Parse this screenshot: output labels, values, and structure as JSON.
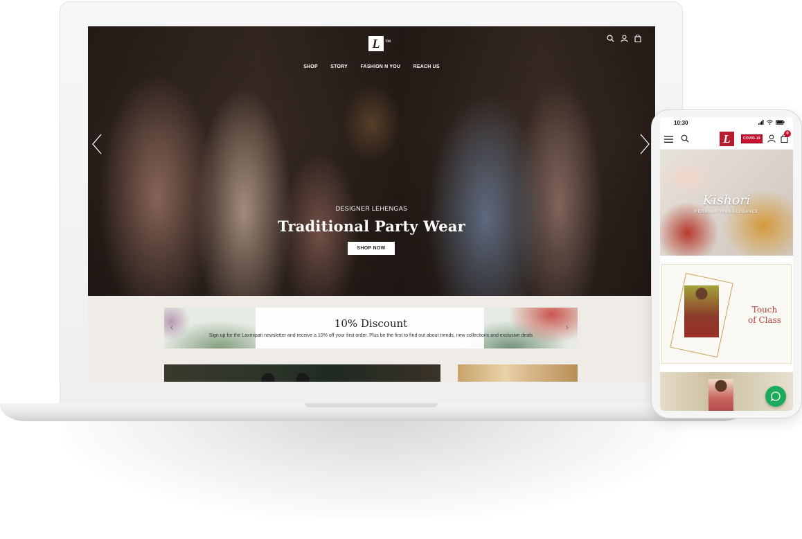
{
  "desktop": {
    "brand": {
      "logo_letter": "L",
      "trademark": "TM"
    },
    "nav": {
      "items": [
        "SHOP",
        "STORY",
        "FASHION N YOU",
        "REACH US"
      ]
    },
    "header_icons": [
      "search-icon",
      "user-icon",
      "bag-icon"
    ],
    "hero": {
      "subtitle": "DESIGNER LEHENGAS",
      "title": "Traditional Party Wear",
      "cta_label": "SHOP NOW",
      "prev_icon": "chevron-left-icon",
      "next_icon": "chevron-right-icon"
    },
    "discount": {
      "title": "10% Discount",
      "text": "Sign up for the Laxmipati newsletter and receive a 10% off your first order. Plus be the first to find out about trends, new collections and exclusive deals"
    }
  },
  "mobile": {
    "status": {
      "time": "10:30"
    },
    "header": {
      "logo_letter": "L",
      "badge": "COVID-19",
      "cart_count": "0"
    },
    "banner_1": {
      "title": "Kishori",
      "subtitle": "PERSONIFYING ELEGANCE"
    },
    "banner_2": {
      "line_1": "Touch",
      "line_2": "of Class"
    },
    "chat_icon": "chat-icon"
  },
  "colors": {
    "brand_red": "#c8102e",
    "whatsapp_green": "#1cab5a",
    "gold": "#c9a458"
  }
}
